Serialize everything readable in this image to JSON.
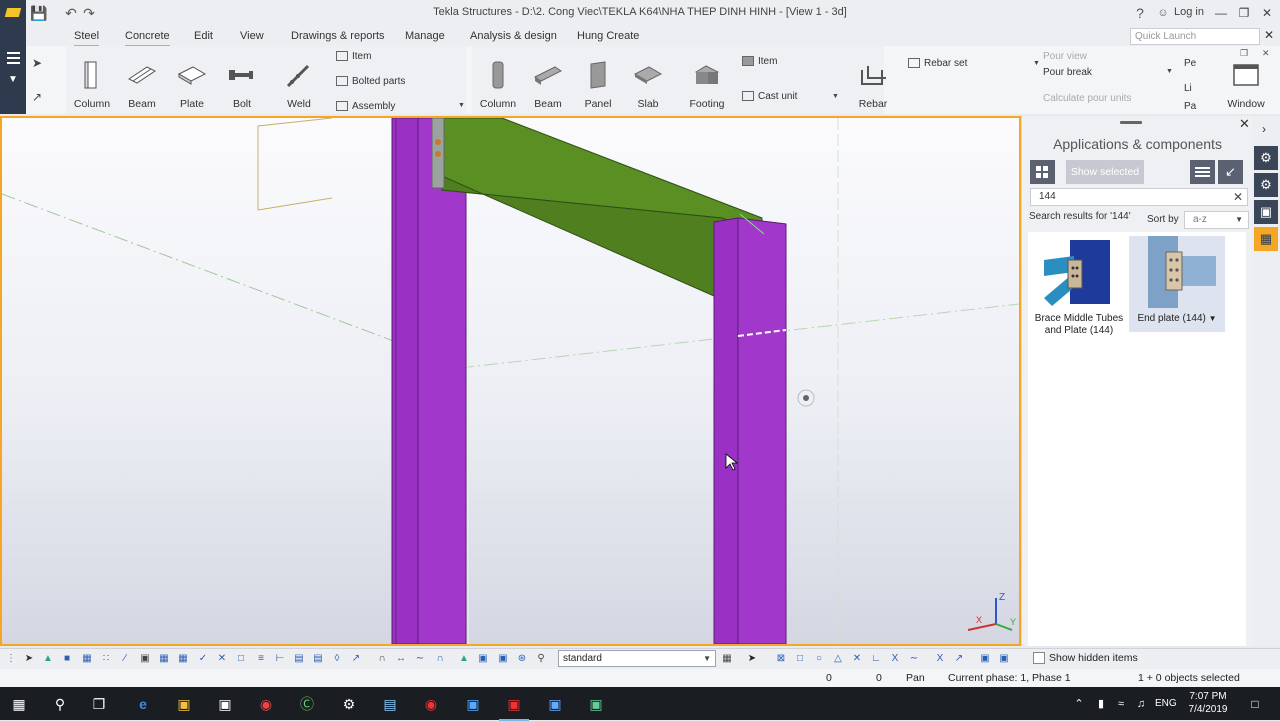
{
  "window": {
    "title": "Tekla Structures - D:\\2. Cong Viec\\TEKLA K64\\NHA THEP DINH HINH  - [View 1 - 3d]",
    "help": "?",
    "login": "Log in"
  },
  "menu": {
    "tabs": [
      "Steel",
      "Concrete",
      "Edit",
      "View",
      "Drawings & reports",
      "Manage",
      "Analysis & design",
      "Hung Create"
    ],
    "quick_launch_placeholder": "Quick Launch"
  },
  "ribbon": {
    "steel": {
      "column": "Column",
      "beam": "Beam",
      "plate": "Plate",
      "bolt": "Bolt",
      "weld": "Weld",
      "item": "Item",
      "bolted_parts": "Bolted parts",
      "assembly": "Assembly"
    },
    "concrete": {
      "column": "Column",
      "beam": "Beam",
      "panel": "Panel",
      "slab": "Slab",
      "footing": "Footing",
      "item": "Item",
      "cast_unit": "Cast unit",
      "rebar": "Rebar",
      "rebar_set": "Rebar set"
    },
    "pour": {
      "pour_view": "Pour view",
      "pour_break": "Pour break",
      "calculate_pour_units": "Calculate pour units"
    },
    "window": "Window",
    "partial_labels": [
      "Pe",
      "Li",
      "Pa"
    ]
  },
  "panel": {
    "title": "Applications & components",
    "show_selected": "Show selected",
    "search_value": "144",
    "results_label": "Search results for '144'",
    "sort_by_label": "Sort by",
    "sort_value": "a-z",
    "results": [
      {
        "name": "Brace Middle Tubes and Plate (144)",
        "selected": false
      },
      {
        "name": "End plate (144)",
        "selected": true
      }
    ]
  },
  "bottom": {
    "view_filter": "standard",
    "show_hidden_items": "Show hidden items"
  },
  "status": {
    "x": "0",
    "y": "0",
    "mode": "Pan",
    "phase": "Current phase: 1, Phase 1",
    "selection": "1 + 0 objects selected"
  },
  "taskbar": {
    "language": "ENG",
    "time": "7:07 PM",
    "date": "7/4/2019"
  },
  "colors": {
    "accent": "#f5a623",
    "column_purple": "#9b30c4",
    "beam_green": "#5a8f24",
    "app_dark": "#2e3a4d"
  }
}
